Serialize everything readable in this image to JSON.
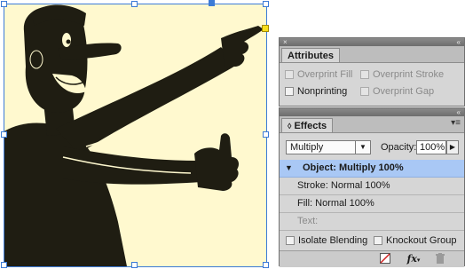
{
  "attributes_panel": {
    "title": "Attributes",
    "collapse_glyph": "«",
    "close_glyph": "×",
    "options": [
      {
        "label": "Overprint Fill",
        "checked": false,
        "enabled": false
      },
      {
        "label": "Overprint Stroke",
        "checked": false,
        "enabled": false
      },
      {
        "label": "Nonprinting",
        "checked": false,
        "enabled": true
      },
      {
        "label": "Overprint Gap",
        "checked": false,
        "enabled": false
      }
    ]
  },
  "effects_panel": {
    "title": "Effects",
    "tab_glyph": "◊",
    "collapse_glyph": "«",
    "menu_glyph": "▾≡",
    "blend_mode": "Multiply",
    "opacity_label": "Opacity:",
    "opacity_value": "100%",
    "rows": {
      "object": "Object: Multiply 100%",
      "stroke": "Stroke:  Normal 100%",
      "fill": "Fill:   Normal 100%",
      "text": "Text:"
    },
    "isolate_blending": "Isolate Blending",
    "knockout_group": "Knockout Group",
    "bottom_icons": {
      "clear_effects": "clear-effects-icon",
      "fx": "fx",
      "fx_arrow": "▾",
      "trash": "trash-icon"
    }
  },
  "colors": {
    "artwork_bg": "#fff9cf",
    "artwork_ink": "#1f1d12",
    "selection": "#3c7bd6",
    "selected_row": "#a9c8f5"
  }
}
